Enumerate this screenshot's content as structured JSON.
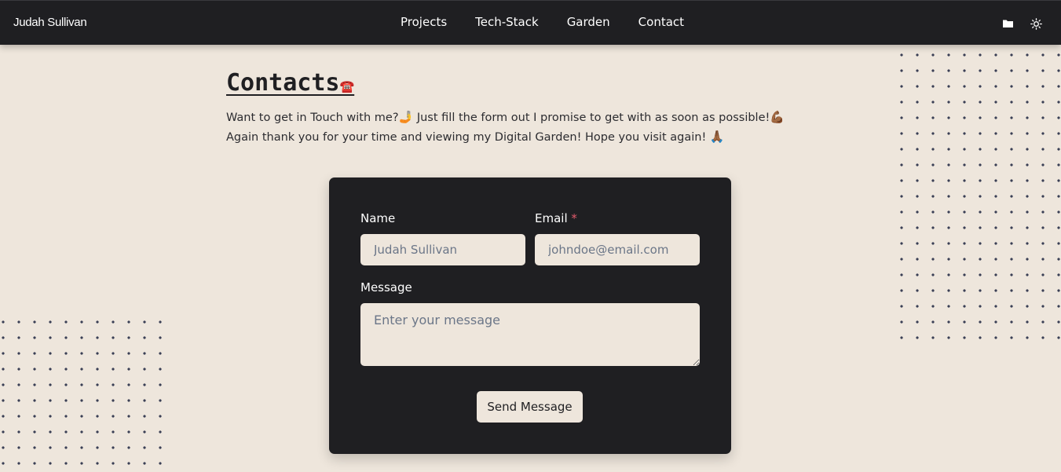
{
  "nav": {
    "brand": "Judah Sullivan",
    "links": [
      "Projects",
      "Tech-Stack",
      "Garden",
      "Contact"
    ],
    "icons": [
      "folder-icon",
      "sun-icon"
    ]
  },
  "page": {
    "title": "Contacts",
    "title_emoji": "☎️",
    "intro_line1": "Want to get in Touch with me?",
    "intro_emoji1": "🤳",
    "intro_line1b": " Just fill the form out I promise to get with as soon as possible!",
    "intro_emoji2": "💪🏾",
    "intro_line2": "Again thank you for your time and viewing my Digital Garden! Hope you visit again!",
    "intro_emoji3": "🙏🏾"
  },
  "form": {
    "name_label": "Name",
    "name_placeholder": "Judah Sullivan",
    "email_label": "Email",
    "email_required_mark": "*",
    "email_placeholder": "johndoe@email.com",
    "message_label": "Message",
    "message_placeholder": "Enter your message",
    "submit_label": "Send Message"
  },
  "colors": {
    "background": "#eee6dc",
    "nav_bg": "#1f1f22",
    "card_bg": "#1f1f22",
    "required": "#e05a6b",
    "placeholder": "#6b7688"
  }
}
